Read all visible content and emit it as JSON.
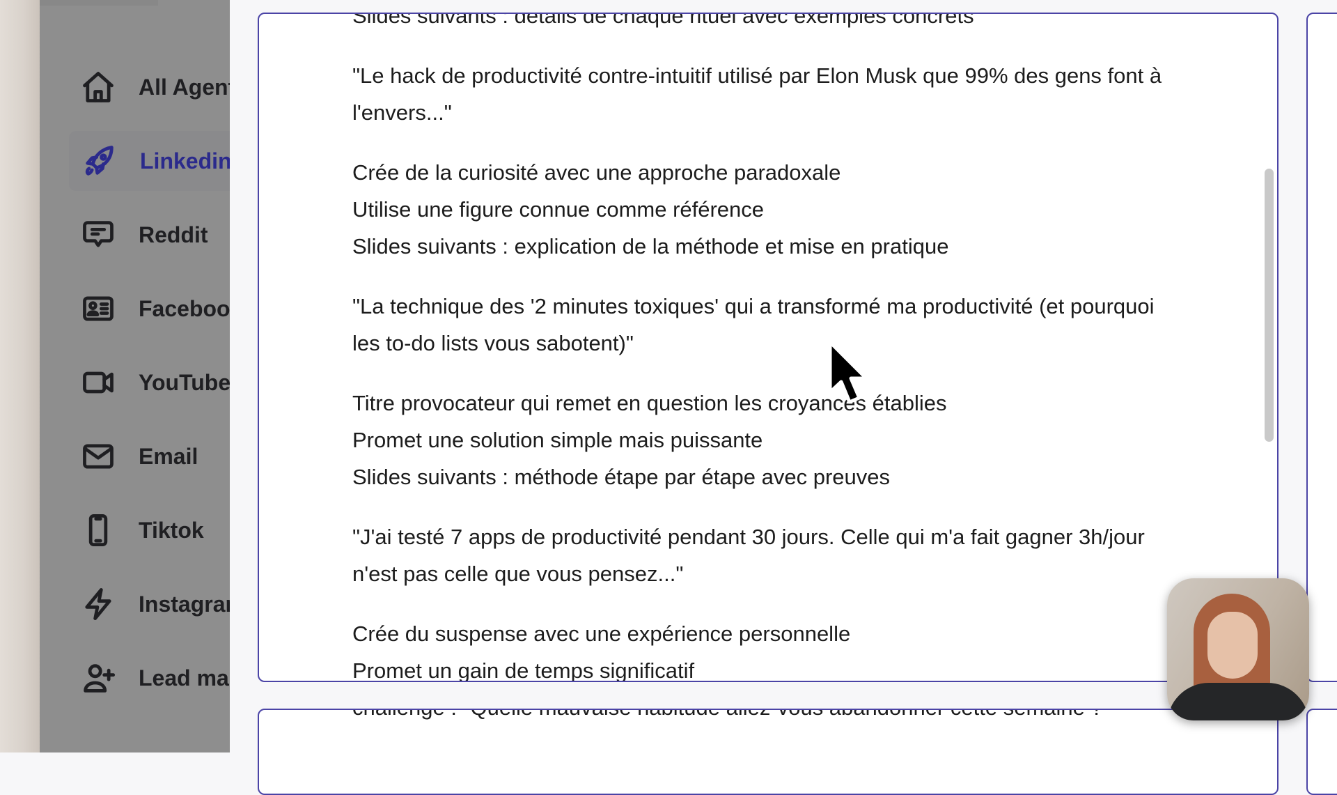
{
  "sidebar": {
    "items": [
      {
        "label": "All Agents",
        "icon": "home-icon",
        "active": false
      },
      {
        "label": "Linkedin",
        "icon": "rocket-icon",
        "active": true
      },
      {
        "label": "Reddit",
        "icon": "chat-bubble-icon",
        "active": false
      },
      {
        "label": "Facebook",
        "icon": "id-card-icon",
        "active": false
      },
      {
        "label": "YouTube",
        "icon": "video-camera-icon",
        "active": false
      },
      {
        "label": "Email",
        "icon": "envelope-icon",
        "active": false
      },
      {
        "label": "Tiktok",
        "icon": "smartphone-icon",
        "active": false
      },
      {
        "label": "Instagram",
        "icon": "lightning-icon",
        "active": false
      },
      {
        "label": "Lead magnet",
        "icon": "user-plus-icon",
        "active": false
      }
    ],
    "active_color": "#2b2a8c"
  },
  "panel": {
    "border_color": "#4b44a6",
    "lines": {
      "l0": "Slides suivants : détails de chaque rituel avec exemples concrets",
      "l1": "\"Le hack de productivité contre-intuitif utilisé par Elon Musk que 99% des gens font à",
      "l2": "l'envers...\"",
      "l3": "Crée de la curiosité avec une approche paradoxale",
      "l4": "Utilise une figure connue comme référence",
      "l5": "Slides suivants : explication de la méthode et mise en pratique",
      "l6": "\"La technique des '2 minutes toxiques' qui a transformé ma productivité (et pourquoi",
      "l7": "les to-do lists vous sabotent)\"",
      "l8": "Titre provocateur qui remet en question les croyances établies",
      "l9": "Promet une solution simple mais puissante",
      "l10": "Slides suivants : méthode étape par étape avec preuves",
      "l11": "\"J'ai testé 7 apps de productivité pendant 30 jours. Celle qui m'a fait gagner 3h/jour",
      "l12": "n'est pas celle que vous pensez...\"",
      "l13": "Crée du suspense avec une expérience personnelle",
      "l14": "Promet un gain de temps significatif"
    }
  },
  "panel2": {
    "line": "challenge : \"Quelle mauvaise habitude allez-vous abandonner cette semaine ?\""
  }
}
